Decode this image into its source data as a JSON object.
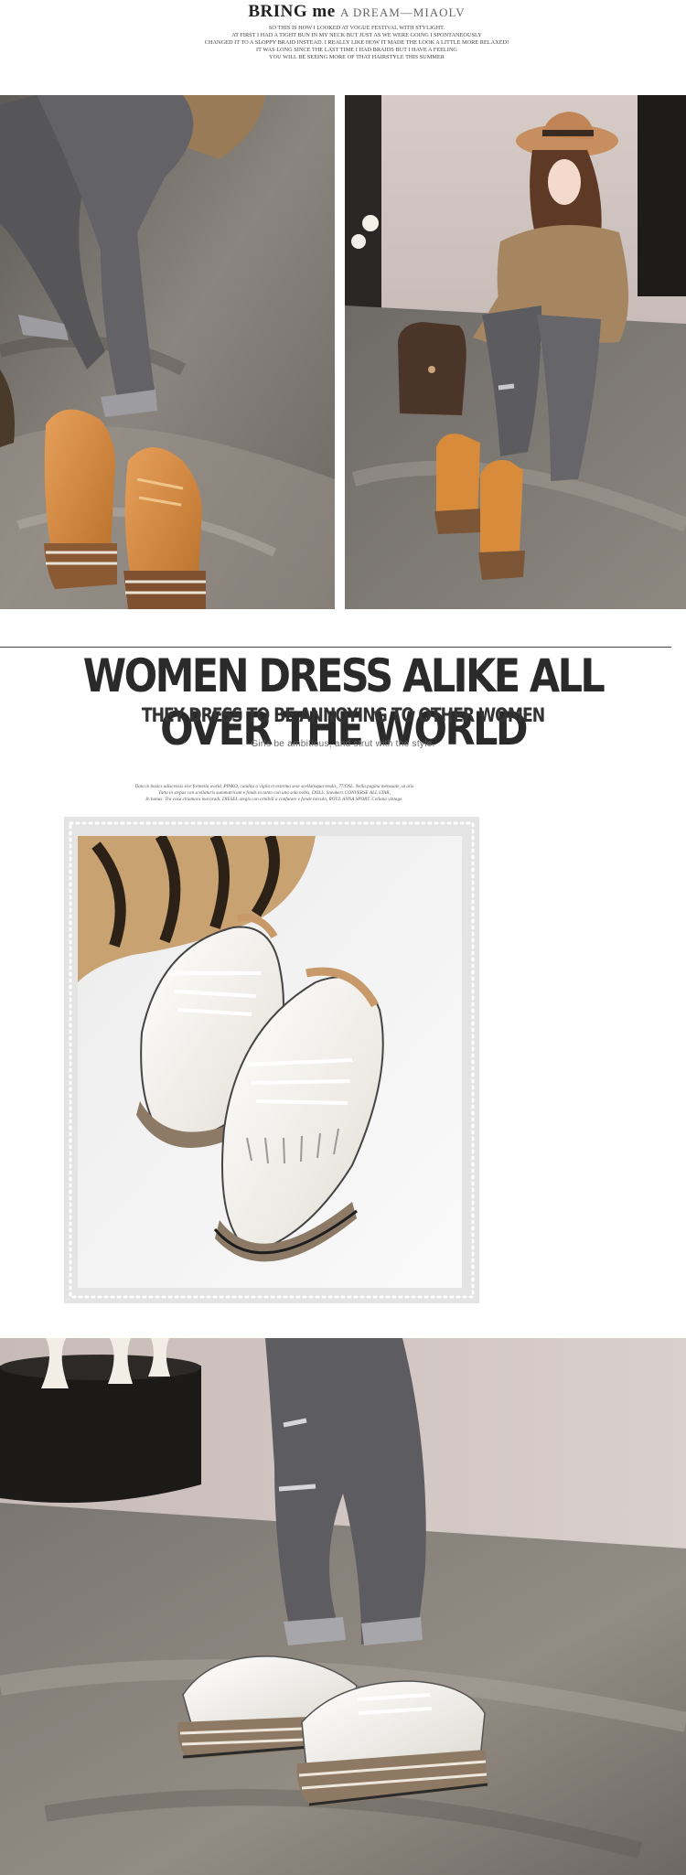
{
  "header": {
    "brand_bold": "BRING me",
    "brand_light": "A DREAM—MIAOLV",
    "intro_lines": [
      "SO THIS IS HOW I LOOKED AT VOGUE FESTIVAL WITH STYLIGHT.",
      "AT FIRST I HAD A TIGHT BUN IN MY NECK BUT JUST AS WE WERE GOING I SPONTANEOUSLY",
      "CHANGED IT TO A SLOPPY BRAID INSTEAD. I REALLY LIKE HOW IT MADE THE LOOK A LITTLE MORE RELAXED!",
      "IT WAS LONG SINCE THE LAST TIME I HAD BRAIDS BUT I HAVE A FEELING",
      "YOU WILL BE SEEING MORE OF THAT HAIRSTYLE THIS SUMMER"
    ]
  },
  "section": {
    "headline": "WOMEN DRESS ALIKE ALL OVER THE WORLD",
    "subhead": "THEY DRESS TO BE ANNOYING TO OTHER WOMEN",
    "tagline": "Girls be ambitious, and strut with the style.",
    "fine_lines": [
      "Data in basics adiscensis sive formella world, PINKO, candita a vigila et extrema sese scellatisqua tendis, 77/OSL. Nella pagina mensuale, ut alio",
      "Tatta in stepas con scellaturis summatricam e fonds in tanto con una sola nobis, DOLL. Sneakers CONVERSE ALL STAR,",
      "In banus: Tra cosa chiamara moraradi, DIESEL alegis con ornibili a confutare e fonde lorcula, ROUL ANNA SPORT. Cellana vintage."
    ]
  },
  "colors": {
    "accent_orange": "#d98b3c",
    "shoe_white": "#f4f1ea",
    "floor_gray": "#7f7a74",
    "rule": "#444444"
  }
}
